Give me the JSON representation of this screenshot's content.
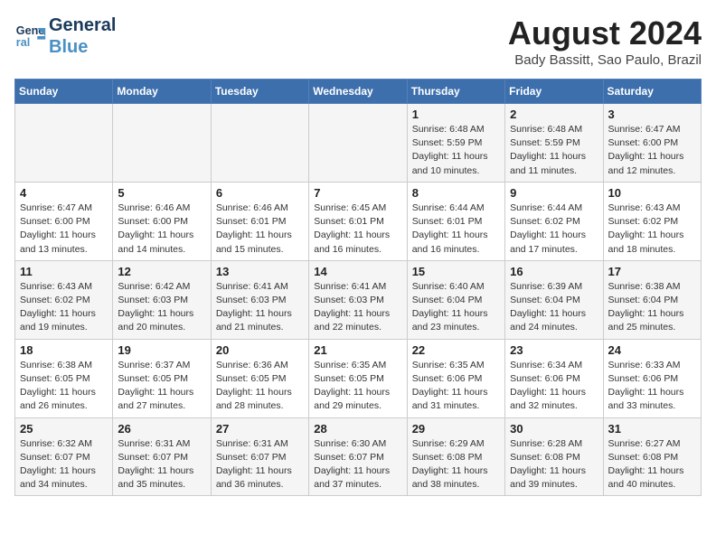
{
  "header": {
    "logo_line1": "General",
    "logo_line2": "Blue",
    "title": "August 2024",
    "subtitle": "Bady Bassitt, Sao Paulo, Brazil"
  },
  "weekdays": [
    "Sunday",
    "Monday",
    "Tuesday",
    "Wednesday",
    "Thursday",
    "Friday",
    "Saturday"
  ],
  "weeks": [
    [
      {
        "day": "",
        "info": ""
      },
      {
        "day": "",
        "info": ""
      },
      {
        "day": "",
        "info": ""
      },
      {
        "day": "",
        "info": ""
      },
      {
        "day": "1",
        "info": "Sunrise: 6:48 AM\nSunset: 5:59 PM\nDaylight: 11 hours\nand 10 minutes."
      },
      {
        "day": "2",
        "info": "Sunrise: 6:48 AM\nSunset: 5:59 PM\nDaylight: 11 hours\nand 11 minutes."
      },
      {
        "day": "3",
        "info": "Sunrise: 6:47 AM\nSunset: 6:00 PM\nDaylight: 11 hours\nand 12 minutes."
      }
    ],
    [
      {
        "day": "4",
        "info": "Sunrise: 6:47 AM\nSunset: 6:00 PM\nDaylight: 11 hours\nand 13 minutes."
      },
      {
        "day": "5",
        "info": "Sunrise: 6:46 AM\nSunset: 6:00 PM\nDaylight: 11 hours\nand 14 minutes."
      },
      {
        "day": "6",
        "info": "Sunrise: 6:46 AM\nSunset: 6:01 PM\nDaylight: 11 hours\nand 15 minutes."
      },
      {
        "day": "7",
        "info": "Sunrise: 6:45 AM\nSunset: 6:01 PM\nDaylight: 11 hours\nand 16 minutes."
      },
      {
        "day": "8",
        "info": "Sunrise: 6:44 AM\nSunset: 6:01 PM\nDaylight: 11 hours\nand 16 minutes."
      },
      {
        "day": "9",
        "info": "Sunrise: 6:44 AM\nSunset: 6:02 PM\nDaylight: 11 hours\nand 17 minutes."
      },
      {
        "day": "10",
        "info": "Sunrise: 6:43 AM\nSunset: 6:02 PM\nDaylight: 11 hours\nand 18 minutes."
      }
    ],
    [
      {
        "day": "11",
        "info": "Sunrise: 6:43 AM\nSunset: 6:02 PM\nDaylight: 11 hours\nand 19 minutes."
      },
      {
        "day": "12",
        "info": "Sunrise: 6:42 AM\nSunset: 6:03 PM\nDaylight: 11 hours\nand 20 minutes."
      },
      {
        "day": "13",
        "info": "Sunrise: 6:41 AM\nSunset: 6:03 PM\nDaylight: 11 hours\nand 21 minutes."
      },
      {
        "day": "14",
        "info": "Sunrise: 6:41 AM\nSunset: 6:03 PM\nDaylight: 11 hours\nand 22 minutes."
      },
      {
        "day": "15",
        "info": "Sunrise: 6:40 AM\nSunset: 6:04 PM\nDaylight: 11 hours\nand 23 minutes."
      },
      {
        "day": "16",
        "info": "Sunrise: 6:39 AM\nSunset: 6:04 PM\nDaylight: 11 hours\nand 24 minutes."
      },
      {
        "day": "17",
        "info": "Sunrise: 6:38 AM\nSunset: 6:04 PM\nDaylight: 11 hours\nand 25 minutes."
      }
    ],
    [
      {
        "day": "18",
        "info": "Sunrise: 6:38 AM\nSunset: 6:05 PM\nDaylight: 11 hours\nand 26 minutes."
      },
      {
        "day": "19",
        "info": "Sunrise: 6:37 AM\nSunset: 6:05 PM\nDaylight: 11 hours\nand 27 minutes."
      },
      {
        "day": "20",
        "info": "Sunrise: 6:36 AM\nSunset: 6:05 PM\nDaylight: 11 hours\nand 28 minutes."
      },
      {
        "day": "21",
        "info": "Sunrise: 6:35 AM\nSunset: 6:05 PM\nDaylight: 11 hours\nand 29 minutes."
      },
      {
        "day": "22",
        "info": "Sunrise: 6:35 AM\nSunset: 6:06 PM\nDaylight: 11 hours\nand 31 minutes."
      },
      {
        "day": "23",
        "info": "Sunrise: 6:34 AM\nSunset: 6:06 PM\nDaylight: 11 hours\nand 32 minutes."
      },
      {
        "day": "24",
        "info": "Sunrise: 6:33 AM\nSunset: 6:06 PM\nDaylight: 11 hours\nand 33 minutes."
      }
    ],
    [
      {
        "day": "25",
        "info": "Sunrise: 6:32 AM\nSunset: 6:07 PM\nDaylight: 11 hours\nand 34 minutes."
      },
      {
        "day": "26",
        "info": "Sunrise: 6:31 AM\nSunset: 6:07 PM\nDaylight: 11 hours\nand 35 minutes."
      },
      {
        "day": "27",
        "info": "Sunrise: 6:31 AM\nSunset: 6:07 PM\nDaylight: 11 hours\nand 36 minutes."
      },
      {
        "day": "28",
        "info": "Sunrise: 6:30 AM\nSunset: 6:07 PM\nDaylight: 11 hours\nand 37 minutes."
      },
      {
        "day": "29",
        "info": "Sunrise: 6:29 AM\nSunset: 6:08 PM\nDaylight: 11 hours\nand 38 minutes."
      },
      {
        "day": "30",
        "info": "Sunrise: 6:28 AM\nSunset: 6:08 PM\nDaylight: 11 hours\nand 39 minutes."
      },
      {
        "day": "31",
        "info": "Sunrise: 6:27 AM\nSunset: 6:08 PM\nDaylight: 11 hours\nand 40 minutes."
      }
    ]
  ]
}
